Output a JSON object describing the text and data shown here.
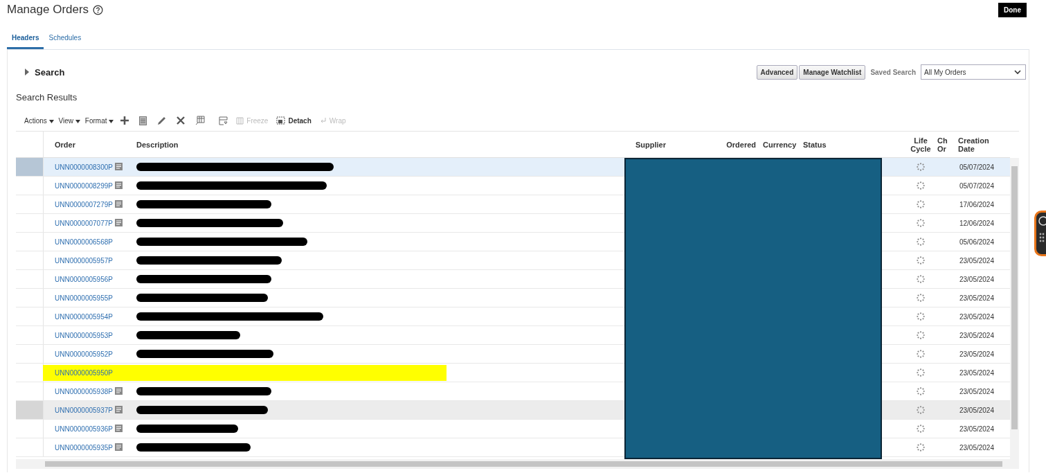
{
  "page": {
    "title": "Manage Orders",
    "done_button": "Done"
  },
  "tabs": [
    {
      "label": "Headers",
      "selected": true
    },
    {
      "label": "Schedules",
      "selected": false
    }
  ],
  "search": {
    "label": "Search",
    "expanded": false,
    "advanced_button": "Advanced",
    "watchlist_button": "Manage Watchlist",
    "saved_search_label": "Saved Search",
    "saved_search_value": "All My Orders"
  },
  "results": {
    "title": "Search Results",
    "menus": [
      "Actions",
      "View",
      "Format"
    ],
    "toolbar": [
      {
        "label": "Freeze",
        "disabled": true
      },
      {
        "label": "Detach",
        "disabled": false
      },
      {
        "label": "Wrap",
        "disabled": true
      }
    ],
    "columns": [
      "Order",
      "Description",
      "Supplier",
      "Ordered",
      "Currency",
      "Status",
      "Life Cycle",
      "Ch Or",
      "Creation Date"
    ],
    "rows": [
      {
        "order": "UNN0000008300P",
        "note": true,
        "highlighted": false,
        "selected": true,
        "hovered": false,
        "date": "05/07/2024"
      },
      {
        "order": "UNN0000008299P",
        "note": true,
        "highlighted": false,
        "selected": false,
        "hovered": false,
        "date": "05/07/2024"
      },
      {
        "order": "UNN0000007279P",
        "note": true,
        "highlighted": false,
        "selected": false,
        "hovered": false,
        "date": "17/06/2024"
      },
      {
        "order": "UNN0000007077P",
        "note": true,
        "highlighted": false,
        "selected": false,
        "hovered": false,
        "date": "12/06/2024"
      },
      {
        "order": "UNN0000006568P",
        "note": false,
        "highlighted": false,
        "selected": false,
        "hovered": false,
        "date": "05/06/2024"
      },
      {
        "order": "UNN0000005957P",
        "note": false,
        "highlighted": false,
        "selected": false,
        "hovered": false,
        "date": "23/05/2024"
      },
      {
        "order": "UNN0000005956P",
        "note": false,
        "highlighted": false,
        "selected": false,
        "hovered": false,
        "date": "23/05/2024"
      },
      {
        "order": "UNN0000005955P",
        "note": false,
        "highlighted": false,
        "selected": false,
        "hovered": false,
        "date": "23/05/2024"
      },
      {
        "order": "UNN0000005954P",
        "note": false,
        "highlighted": false,
        "selected": false,
        "hovered": false,
        "date": "23/05/2024"
      },
      {
        "order": "UNN0000005953P",
        "note": false,
        "highlighted": false,
        "selected": false,
        "hovered": false,
        "date": "23/05/2024"
      },
      {
        "order": "UNN0000005952P",
        "note": false,
        "highlighted": false,
        "selected": false,
        "hovered": false,
        "date": "23/05/2024"
      },
      {
        "order": "UNN0000005950P",
        "note": false,
        "highlighted": true,
        "selected": false,
        "hovered": false,
        "date": "23/05/2024"
      },
      {
        "order": "UNN0000005938P",
        "note": true,
        "highlighted": false,
        "selected": false,
        "hovered": false,
        "date": "23/05/2024"
      },
      {
        "order": "UNN0000005937P",
        "note": true,
        "highlighted": false,
        "selected": false,
        "hovered": true,
        "date": "23/05/2024"
      },
      {
        "order": "UNN0000005936P",
        "note": true,
        "highlighted": false,
        "selected": false,
        "hovered": false,
        "date": "23/05/2024"
      },
      {
        "order": "UNN0000005935P",
        "note": true,
        "highlighted": false,
        "selected": false,
        "hovered": false,
        "date": "23/05/2024"
      }
    ]
  }
}
